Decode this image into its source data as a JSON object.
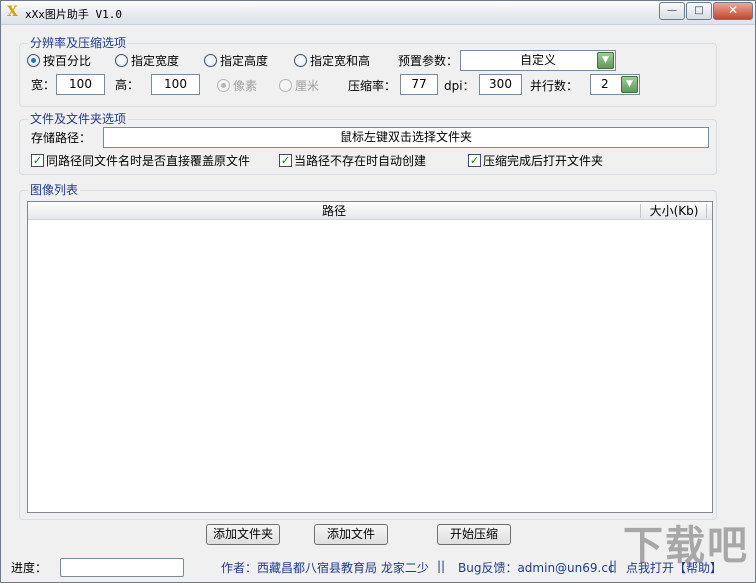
{
  "window": {
    "title": "xXx图片助手 V1.0",
    "icon_letter": "X",
    "controls": {
      "minimize": "—",
      "maximize": "□",
      "close": "✕"
    }
  },
  "resolution_group": {
    "legend": "分辨率及压缩选项",
    "mode_options": [
      {
        "label": "按百分比",
        "checked": true
      },
      {
        "label": "指定宽度",
        "checked": false
      },
      {
        "label": "指定高度",
        "checked": false
      },
      {
        "label": "指定宽和高",
        "checked": false
      }
    ],
    "preset_label": "预置参数：",
    "preset_value": "自定义",
    "width_label": "宽：",
    "width_value": "100",
    "height_label": "高：",
    "height_value": "100",
    "unit_options": [
      {
        "label": "像素",
        "checked": true
      },
      {
        "label": "厘米",
        "checked": false
      }
    ],
    "compression_label": "压缩率：",
    "compression_value": "77",
    "dpi_label": "dpi：",
    "dpi_value": "300",
    "parallel_label": "并行数：",
    "parallel_value": "2"
  },
  "folder_group": {
    "legend": "文件及文件夹选项",
    "save_path_label": "存储路径：",
    "save_path_value": "鼠标左键双击选择文件夹",
    "checks": [
      {
        "label": "同路径同文件名时是否直接覆盖原文件",
        "checked": true
      },
      {
        "label": "当路径不存在时自动创建",
        "checked": true
      },
      {
        "label": "压缩完成后打开文件夹",
        "checked": true
      }
    ]
  },
  "image_list": {
    "legend": "图像列表",
    "columns": [
      "路径",
      "大小(Kb)"
    ],
    "rows": []
  },
  "buttons": {
    "add_folder": "添加文件夹",
    "add_file": "添加文件",
    "start": "开始压缩"
  },
  "status": {
    "progress_label": "进度：",
    "progress_value": 0,
    "author": "作者：西藏昌都八宿县教育局 龙家二少",
    "sep1": "||",
    "bug": "Bug反馈：admin@un69.cc",
    "sep2": "||",
    "help": "点我打开【帮助】"
  },
  "watermark": "下载吧"
}
